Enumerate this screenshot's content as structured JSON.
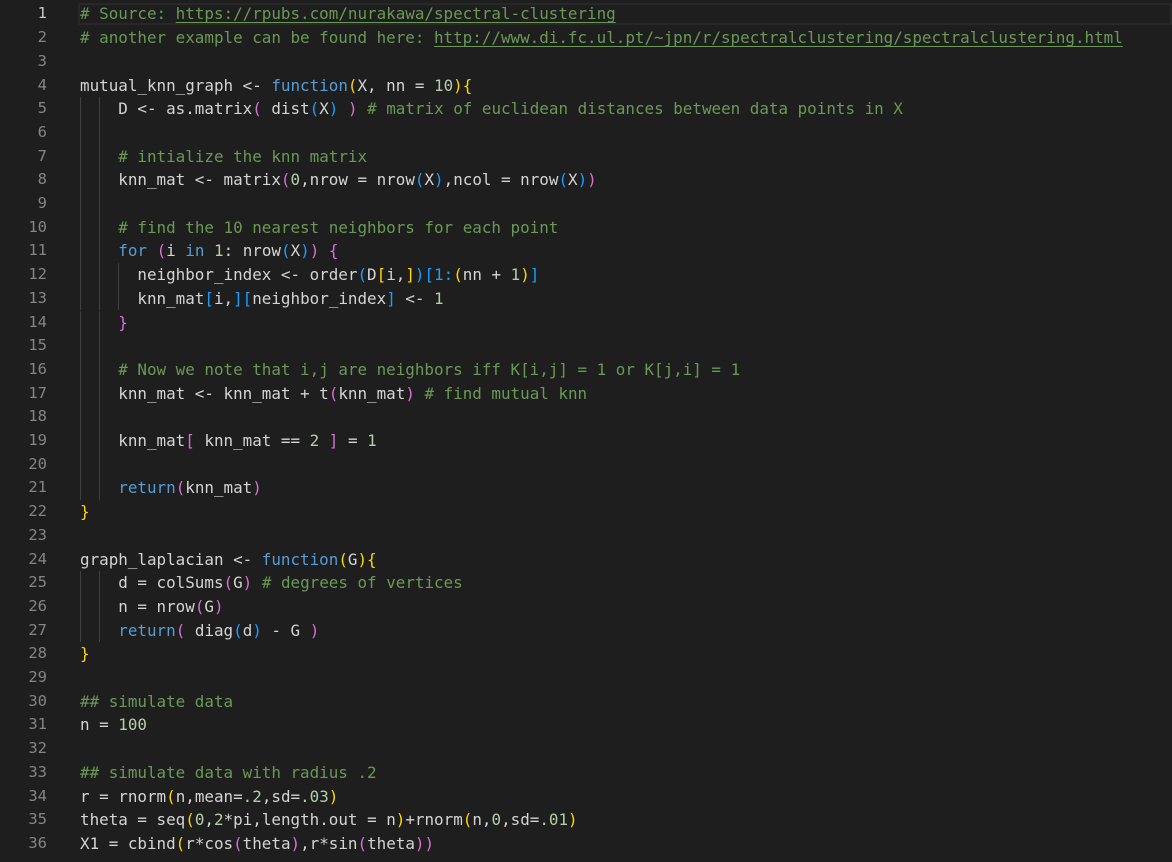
{
  "editor": {
    "language": "R",
    "current_line": 1,
    "colors": {
      "background": "#1e1e1e",
      "line_number": "#858585",
      "comment": "#6a9955",
      "keyword": "#569cd6",
      "number": "#b5cea8",
      "text": "#d4d4d4",
      "bracket_level_1": "#ffd700",
      "bracket_level_2": "#da70d6",
      "bracket_level_3": "#179fff"
    },
    "lines": [
      {
        "n": "1",
        "indent_guides": [],
        "tokens": [
          [
            "comment",
            "# Source: "
          ],
          [
            "link",
            "https://rpubs.com/nurakawa/spectral-clustering"
          ]
        ]
      },
      {
        "n": "2",
        "indent_guides": [],
        "tokens": [
          [
            "comment",
            "# another example can be found here: "
          ],
          [
            "link",
            "http://www.di.fc.ul.pt/~jpn/r/spectralclustering/spectralclustering.html"
          ]
        ]
      },
      {
        "n": "3",
        "indent_guides": [],
        "tokens": []
      },
      {
        "n": "4",
        "indent_guides": [],
        "tokens": [
          [
            "text",
            "mutual_knn_graph <- "
          ],
          [
            "kw",
            "function"
          ],
          [
            "b1",
            "("
          ],
          [
            "text",
            "X, nn = "
          ],
          [
            "num",
            "10"
          ],
          [
            "b1",
            "){"
          ]
        ]
      },
      {
        "n": "5",
        "indent_guides": [
          0,
          2
        ],
        "tokens": [
          [
            "text",
            "    D <- as.matrix"
          ],
          [
            "b2",
            "("
          ],
          [
            "text",
            " dist"
          ],
          [
            "b3",
            "("
          ],
          [
            "text",
            "X"
          ],
          [
            "b3",
            ")"
          ],
          [
            "text",
            " "
          ],
          [
            "b2",
            ")"
          ],
          [
            "comment",
            " # matrix of euclidean distances between data points in X"
          ]
        ]
      },
      {
        "n": "6",
        "indent_guides": [
          0,
          2
        ],
        "tokens": []
      },
      {
        "n": "7",
        "indent_guides": [
          0,
          2
        ],
        "tokens": [
          [
            "text",
            "    "
          ],
          [
            "comment",
            "# intialize the knn matrix"
          ]
        ]
      },
      {
        "n": "8",
        "indent_guides": [
          0,
          2
        ],
        "tokens": [
          [
            "text",
            "    knn_mat <- matrix"
          ],
          [
            "b2",
            "("
          ],
          [
            "num",
            "0"
          ],
          [
            "text",
            ",nrow = nrow"
          ],
          [
            "b3",
            "("
          ],
          [
            "text",
            "X"
          ],
          [
            "b3",
            ")"
          ],
          [
            "text",
            ",ncol = nrow"
          ],
          [
            "b3",
            "("
          ],
          [
            "text",
            "X"
          ],
          [
            "b3",
            ")"
          ],
          [
            "b2",
            ")"
          ]
        ]
      },
      {
        "n": "9",
        "indent_guides": [
          0,
          2
        ],
        "tokens": []
      },
      {
        "n": "10",
        "indent_guides": [
          0,
          2
        ],
        "tokens": [
          [
            "text",
            "    "
          ],
          [
            "comment",
            "# find the 10 nearest neighbors for each point"
          ]
        ]
      },
      {
        "n": "11",
        "indent_guides": [
          0,
          2
        ],
        "tokens": [
          [
            "text",
            "    "
          ],
          [
            "kw",
            "for"
          ],
          [
            "text",
            " "
          ],
          [
            "b2",
            "("
          ],
          [
            "text",
            "i "
          ],
          [
            "kw",
            "in"
          ],
          [
            "text",
            " "
          ],
          [
            "num",
            "1"
          ],
          [
            "text",
            ": nrow"
          ],
          [
            "b3",
            "("
          ],
          [
            "text",
            "X"
          ],
          [
            "b3",
            ")"
          ],
          [
            "b2",
            ")"
          ],
          [
            "text",
            " "
          ],
          [
            "b2",
            "{"
          ]
        ]
      },
      {
        "n": "12",
        "indent_guides": [
          0,
          2,
          4
        ],
        "tokens": [
          [
            "text",
            "      neighbor_index <- order"
          ],
          [
            "b3",
            "("
          ],
          [
            "text",
            "D"
          ],
          [
            "b1",
            "["
          ],
          [
            "text",
            "i,"
          ],
          [
            "b1",
            "]"
          ],
          [
            "b3",
            ")[1:"
          ],
          [
            "b1",
            "("
          ],
          [
            "text",
            "nn + "
          ],
          [
            "num",
            "1"
          ],
          [
            "b1",
            ")"
          ],
          [
            "b3",
            "]"
          ]
        ]
      },
      {
        "n": "13",
        "indent_guides": [
          0,
          2,
          4
        ],
        "tokens": [
          [
            "text",
            "      knn_mat"
          ],
          [
            "b3",
            "["
          ],
          [
            "text",
            "i,"
          ],
          [
            "b3",
            "]["
          ],
          [
            "text",
            "neighbor_index"
          ],
          [
            "b3",
            "]"
          ],
          [
            "text",
            " <- "
          ],
          [
            "num",
            "1"
          ]
        ]
      },
      {
        "n": "14",
        "indent_guides": [
          0,
          2
        ],
        "tokens": [
          [
            "text",
            "    "
          ],
          [
            "b2",
            "}"
          ]
        ]
      },
      {
        "n": "15",
        "indent_guides": [
          0,
          2
        ],
        "tokens": []
      },
      {
        "n": "16",
        "indent_guides": [
          0,
          2
        ],
        "tokens": [
          [
            "text",
            "    "
          ],
          [
            "comment",
            "# Now we note that i,j are neighbors iff K[i,j] = 1 or K[j,i] = 1"
          ]
        ]
      },
      {
        "n": "17",
        "indent_guides": [
          0,
          2
        ],
        "tokens": [
          [
            "text",
            "    knn_mat <- knn_mat + t"
          ],
          [
            "b2",
            "("
          ],
          [
            "text",
            "knn_mat"
          ],
          [
            "b2",
            ")"
          ],
          [
            "comment",
            " # find mutual knn"
          ]
        ]
      },
      {
        "n": "18",
        "indent_guides": [
          0,
          2
        ],
        "tokens": []
      },
      {
        "n": "19",
        "indent_guides": [
          0,
          2
        ],
        "tokens": [
          [
            "text",
            "    knn_mat"
          ],
          [
            "b2",
            "["
          ],
          [
            "text",
            " knn_mat == "
          ],
          [
            "num",
            "2"
          ],
          [
            "text",
            " "
          ],
          [
            "b2",
            "]"
          ],
          [
            "text",
            " = "
          ],
          [
            "num",
            "1"
          ]
        ]
      },
      {
        "n": "20",
        "indent_guides": [
          0,
          2
        ],
        "tokens": []
      },
      {
        "n": "21",
        "indent_guides": [
          0,
          2
        ],
        "tokens": [
          [
            "text",
            "    "
          ],
          [
            "kw",
            "return"
          ],
          [
            "b2",
            "("
          ],
          [
            "text",
            "knn_mat"
          ],
          [
            "b2",
            ")"
          ]
        ]
      },
      {
        "n": "22",
        "indent_guides": [],
        "tokens": [
          [
            "b1",
            "}"
          ]
        ]
      },
      {
        "n": "23",
        "indent_guides": [],
        "tokens": []
      },
      {
        "n": "24",
        "indent_guides": [],
        "tokens": [
          [
            "text",
            "graph_laplacian <- "
          ],
          [
            "kw",
            "function"
          ],
          [
            "b1",
            "("
          ],
          [
            "text",
            "G"
          ],
          [
            "b1",
            "){"
          ]
        ]
      },
      {
        "n": "25",
        "indent_guides": [
          0,
          2
        ],
        "tokens": [
          [
            "text",
            "    d = colSums"
          ],
          [
            "b2",
            "("
          ],
          [
            "text",
            "G"
          ],
          [
            "b2",
            ")"
          ],
          [
            "comment",
            " # degrees of vertices"
          ]
        ]
      },
      {
        "n": "26",
        "indent_guides": [
          0,
          2
        ],
        "tokens": [
          [
            "text",
            "    n = nrow"
          ],
          [
            "b2",
            "("
          ],
          [
            "text",
            "G"
          ],
          [
            "b2",
            ")"
          ]
        ]
      },
      {
        "n": "27",
        "indent_guides": [
          0,
          2
        ],
        "tokens": [
          [
            "text",
            "    "
          ],
          [
            "kw",
            "return"
          ],
          [
            "b2",
            "("
          ],
          [
            "text",
            " diag"
          ],
          [
            "b3",
            "("
          ],
          [
            "text",
            "d"
          ],
          [
            "b3",
            ")"
          ],
          [
            "text",
            " - G "
          ],
          [
            "b2",
            ")"
          ]
        ]
      },
      {
        "n": "28",
        "indent_guides": [],
        "tokens": [
          [
            "b1",
            "}"
          ]
        ]
      },
      {
        "n": "29",
        "indent_guides": [],
        "tokens": []
      },
      {
        "n": "30",
        "indent_guides": [],
        "tokens": [
          [
            "comment",
            "## simulate data"
          ]
        ]
      },
      {
        "n": "31",
        "indent_guides": [],
        "tokens": [
          [
            "text",
            "n = "
          ],
          [
            "num",
            "100"
          ]
        ]
      },
      {
        "n": "32",
        "indent_guides": [],
        "tokens": []
      },
      {
        "n": "33",
        "indent_guides": [],
        "tokens": [
          [
            "comment",
            "## simulate data with radius .2"
          ]
        ]
      },
      {
        "n": "34",
        "indent_guides": [],
        "tokens": [
          [
            "text",
            "r = rnorm"
          ],
          [
            "b1",
            "("
          ],
          [
            "text",
            "n,mean="
          ],
          [
            "num",
            ".2"
          ],
          [
            "text",
            ",sd="
          ],
          [
            "num",
            ".03"
          ],
          [
            "b1",
            ")"
          ]
        ]
      },
      {
        "n": "35",
        "indent_guides": [],
        "tokens": [
          [
            "text",
            "theta = seq"
          ],
          [
            "b1",
            "("
          ],
          [
            "num",
            "0"
          ],
          [
            "text",
            ","
          ],
          [
            "num",
            "2"
          ],
          [
            "text",
            "*pi,length.out = n"
          ],
          [
            "b1",
            ")"
          ],
          [
            "text",
            "+rnorm"
          ],
          [
            "b1",
            "("
          ],
          [
            "text",
            "n,"
          ],
          [
            "num",
            "0"
          ],
          [
            "text",
            ",sd="
          ],
          [
            "num",
            ".01"
          ],
          [
            "b1",
            ")"
          ]
        ]
      },
      {
        "n": "36",
        "indent_guides": [],
        "tokens": [
          [
            "text",
            "X1 = cbind"
          ],
          [
            "b1",
            "("
          ],
          [
            "text",
            "r*cos"
          ],
          [
            "b2",
            "("
          ],
          [
            "text",
            "theta"
          ],
          [
            "b2",
            ")"
          ],
          [
            "text",
            ",r*sin"
          ],
          [
            "b2",
            "("
          ],
          [
            "text",
            "theta"
          ],
          [
            "b2",
            "))"
          ]
        ]
      }
    ]
  }
}
